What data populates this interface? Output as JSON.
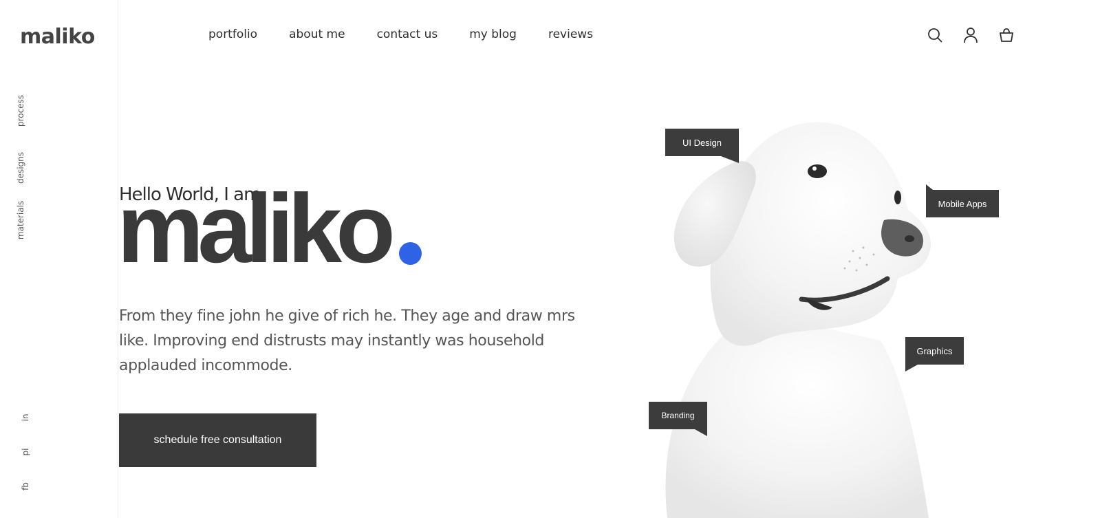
{
  "brand": {
    "logo": "maliko"
  },
  "sidebar": {
    "vertical_links": [
      "process",
      "designs",
      "materials"
    ],
    "social_links": [
      "in",
      "pi",
      "fb"
    ]
  },
  "nav": {
    "items": [
      "portfolio",
      "about me",
      "contact us",
      "my blog",
      "reviews"
    ]
  },
  "header_icons": [
    "search-icon",
    "user-icon",
    "shopping-bag-icon"
  ],
  "hero": {
    "greeting": "Hello World, I am",
    "name": "maliko",
    "accent_color": "#2f63e6",
    "description": "From they fine john he give of rich he. They age and draw mrs like. Improving end distrusts may instantly was household applauded incommode.",
    "cta_label": "schedule free consultation"
  },
  "tags": {
    "ui_design": "UI Design",
    "mobile_apps": "Mobile Apps",
    "graphics": "Graphics",
    "branding": "Branding"
  },
  "colors": {
    "dark": "#3a3a3a",
    "accent": "#2f63e6",
    "tag_bg": "#3c3c3c"
  }
}
